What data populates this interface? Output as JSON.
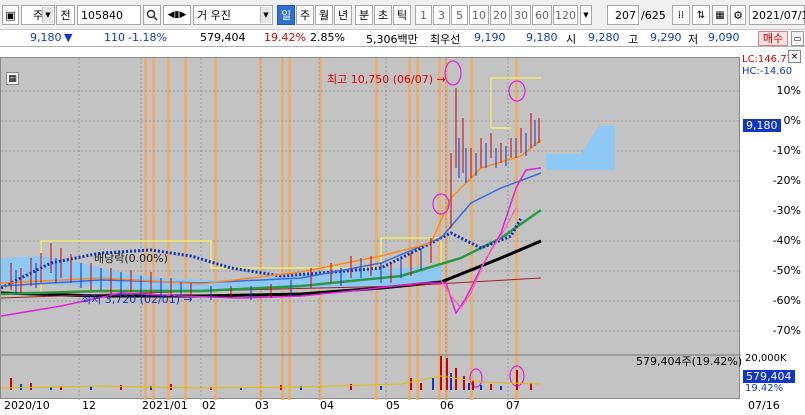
{
  "toolbar": {
    "chart_icon": "chart-icon",
    "market_select": "주",
    "prev_label": "전",
    "code": "105840",
    "search_icon": "search-icon",
    "nav_icon": "nav-back-icon",
    "stock_name": "거 우진",
    "periods": [
      "일",
      "주",
      "월",
      "년",
      "분",
      "초",
      "틱"
    ],
    "active_period": "일",
    "minutes": [
      "1",
      "3",
      "5",
      "10",
      "20",
      "30",
      "60",
      "120"
    ],
    "count": "207",
    "total": "/625",
    "date": "2021/07/1"
  },
  "info": {
    "price": "9,180",
    "change_arrow": "▼",
    "change": "110",
    "change_pct": "-1.18%",
    "volume": "579,404",
    "volume_pct": "19.42%",
    "turnover_pct": "2.85%",
    "amount": "5,306백만",
    "bid_label": "최우선",
    "bid": "9,190",
    "ask": "9,180",
    "open_label": "시",
    "open": "9,280",
    "high_label": "고",
    "high": "9,290",
    "low_label": "저",
    "low": "9,090",
    "trade_button": "매수"
  },
  "chart": {
    "annotations": {
      "high": "최고 10,750 (06/07)",
      "low": "최저 3,720 (02/01)",
      "dividend": "배당락(0.00%)"
    },
    "lc": "LC:146.77",
    "hc": "HC:-14.60",
    "current_price_badge": "9,180",
    "current_change_badge": "-1.18%",
    "volume_line": "579,404주(19.42%)",
    "volume_badge": "579,404",
    "volume_pct_badge": "19.42%",
    "volume_axis": "20,000K",
    "y_ticks": [
      "10%",
      "0%",
      "-10%",
      "-20%",
      "-30%",
      "-40%",
      "-50%",
      "-60%",
      "-70%"
    ],
    "x_ticks": [
      "2020/10",
      "12",
      "2021/01",
      "02",
      "03",
      "04",
      "05",
      "06",
      "07",
      "07/16"
    ]
  },
  "colors": {
    "price_up": "#d00000",
    "price_down": "#1036c8",
    "plot_bg": "#c3c3c3",
    "vertical_band": "#f4a040",
    "cloud": "#8ec8f4"
  }
}
